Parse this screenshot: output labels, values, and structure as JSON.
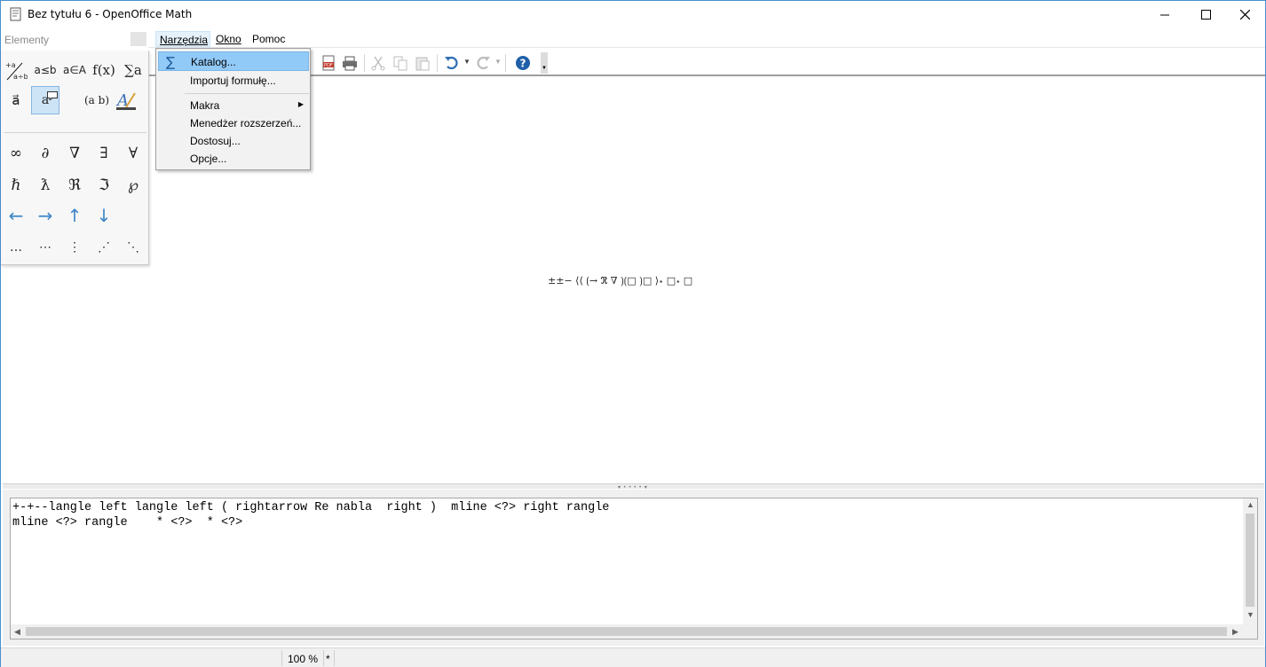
{
  "window": {
    "title": "Bez tytułu 6 - OpenOffice Math",
    "min_icon": "minimize-icon",
    "max_icon": "maximize-icon",
    "close_icon": "close-icon"
  },
  "elements_panel": {
    "title": "Elementy",
    "row1": [
      "+a/a÷b",
      "a≤b",
      "a∈A",
      "f(x)",
      "∑a"
    ],
    "row2": [
      "a⃗",
      "a",
      "(a b)",
      "A"
    ],
    "symbols_row1": [
      "∞",
      "∂",
      "∇",
      "∃",
      "∀"
    ],
    "symbols_row2": [
      "ℏ",
      "ƛ",
      "ℜ",
      "ℑ",
      "℘"
    ],
    "arrows": [
      "←",
      "→",
      "↑",
      "↓"
    ],
    "dots": [
      "…",
      "⋯",
      "⋮",
      "⋰",
      "⋱"
    ]
  },
  "menubar": {
    "narzedzia": "Narzędzia",
    "okno": "Okno",
    "pomoc": "Pomoc"
  },
  "dropdown": {
    "katalog": "Katalog...",
    "importuj": "Importuj formułę...",
    "makra": "Makra",
    "menedzer": "Menedżer rozszerzeń...",
    "dostosuj": "Dostosuj...",
    "opcje": "Opcje..."
  },
  "formula_render": "±±− ⟨⟨ ⟮→ ℜ ∇ ⟯⟮□ ⟯□ ⟩⋆ □⋆ □",
  "command": {
    "line1": "+-+--langle left langle left ( rightarrow Re nabla  right )  mline <?> right rangle",
    "line2": "mline <?> rangle    * <?>  * <?>"
  },
  "statusbar": {
    "zoom": "100 %",
    "modified": "*"
  },
  "colors": {
    "accent": "#3d85c6",
    "menu_highlight": "#91c9f7",
    "window_border": "#4a8fcf"
  }
}
